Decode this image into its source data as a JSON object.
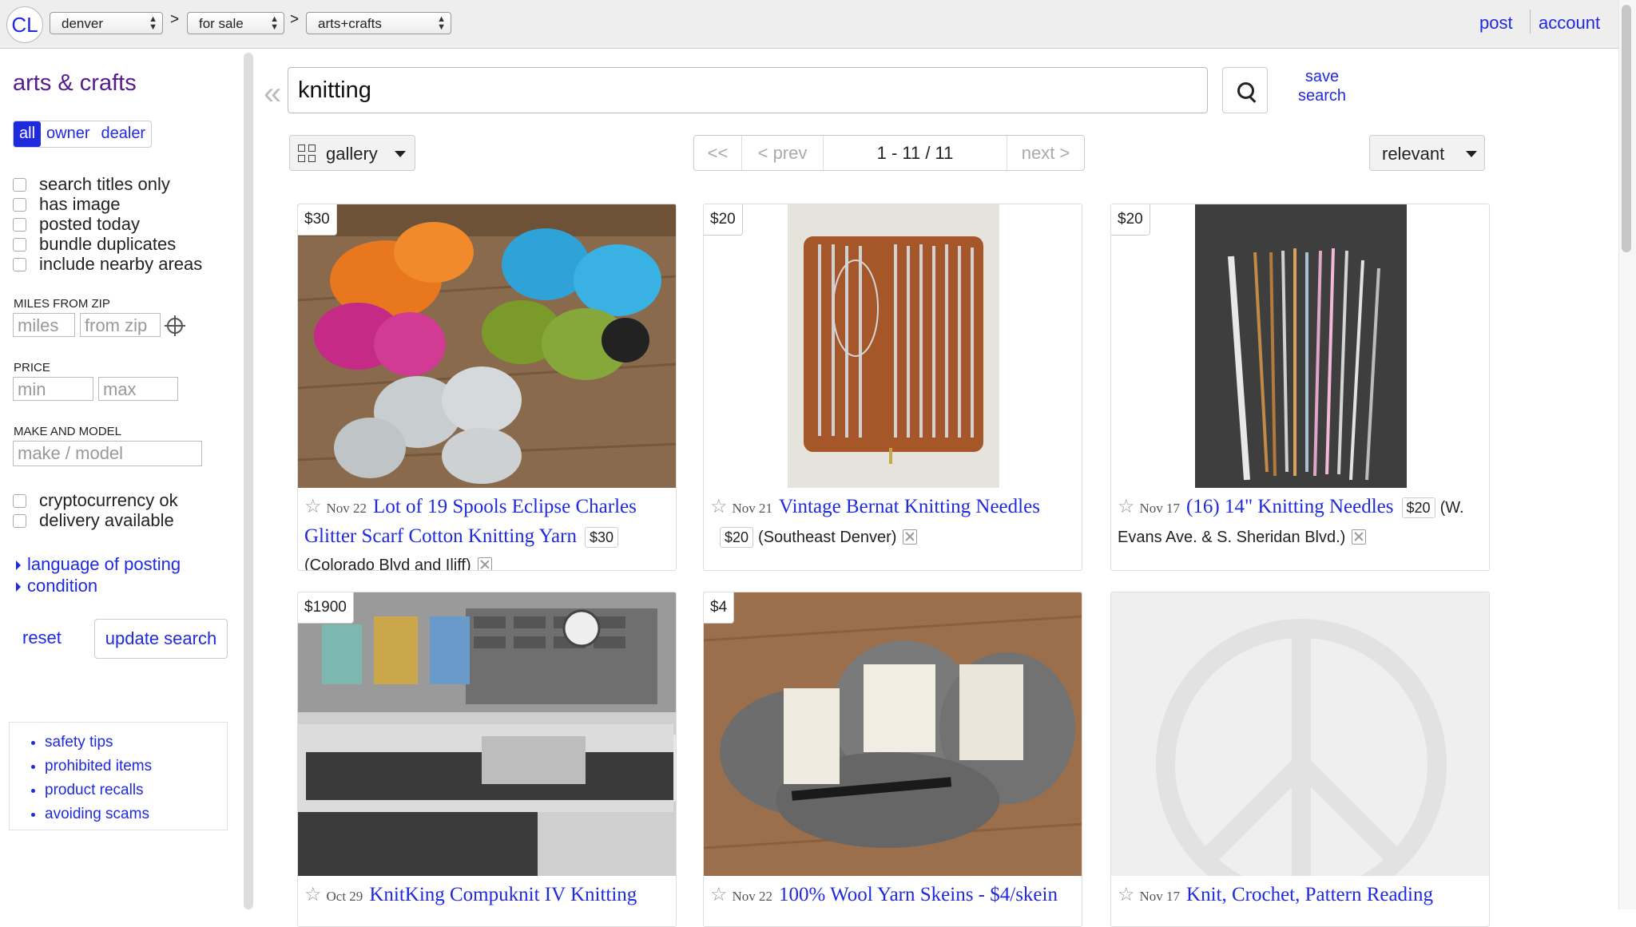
{
  "header": {
    "logo": "CL",
    "crumbs": [
      "denver",
      "for sale",
      "arts+crafts"
    ],
    "separator": ">",
    "post": "post",
    "account": "account"
  },
  "sidebar": {
    "category_title": "arts & crafts",
    "seller_tabs": [
      "all",
      "owner",
      "dealer"
    ],
    "checkboxes_top": [
      "search titles only",
      "has image",
      "posted today",
      "bundle duplicates",
      "include nearby areas"
    ],
    "miles_label": "MILES FROM ZIP",
    "miles_placeholder": "miles",
    "zip_placeholder": "from zip",
    "price_label": "PRICE",
    "min_placeholder": "min",
    "max_placeholder": "max",
    "make_label": "MAKE AND MODEL",
    "make_placeholder": "make / model",
    "checkboxes_bottom": [
      "cryptocurrency ok",
      "delivery available"
    ],
    "expanders": [
      "language of posting",
      "condition"
    ],
    "reset": "reset",
    "update": "update search",
    "links": [
      "safety tips",
      "prohibited items",
      "product recalls",
      "avoiding scams"
    ]
  },
  "search": {
    "collapse": "«",
    "query": "knitting",
    "save_search": "save search"
  },
  "toolbar": {
    "view": "gallery",
    "pager": {
      "first": "<<",
      "prev": "< prev",
      "range": "1 - 11 / 11",
      "next": "next >"
    },
    "sort": "relevant"
  },
  "listings": [
    {
      "price": "$30",
      "date": "Nov 22",
      "title": "Lot of 19 Spools Eclipse Charles Glitter Scarf Cotton Knitting Yarn",
      "inline_price": "$30",
      "hood": "(Colorado Blvd and Iliff)"
    },
    {
      "price": "$20",
      "date": "Nov 21",
      "title": "Vintage Bernat Knitting Needles",
      "inline_price": "$20",
      "hood": "(Southeast Denver)"
    },
    {
      "price": "$20",
      "date": "Nov 17",
      "title": "(16) 14\" Knitting Needles",
      "inline_price": "$20",
      "hood": "(W. Evans Ave. & S. Sheridan Blvd.)"
    },
    {
      "price": "$1900",
      "date": "Oct 29",
      "title": "KnitKing Compuknit IV Knitting",
      "inline_price": "",
      "hood": ""
    },
    {
      "price": "$4",
      "date": "Nov 22",
      "title": "100% Wool Yarn Skeins - $4/skein",
      "inline_price": "",
      "hood": ""
    },
    {
      "price": "",
      "date": "Nov 17",
      "title": "Knit, Crochet, Pattern Reading",
      "inline_price": "",
      "hood": ""
    }
  ],
  "colors": {
    "link": "#1f29e0",
    "category": "#551a8b",
    "topbar": "#eeeeee"
  }
}
